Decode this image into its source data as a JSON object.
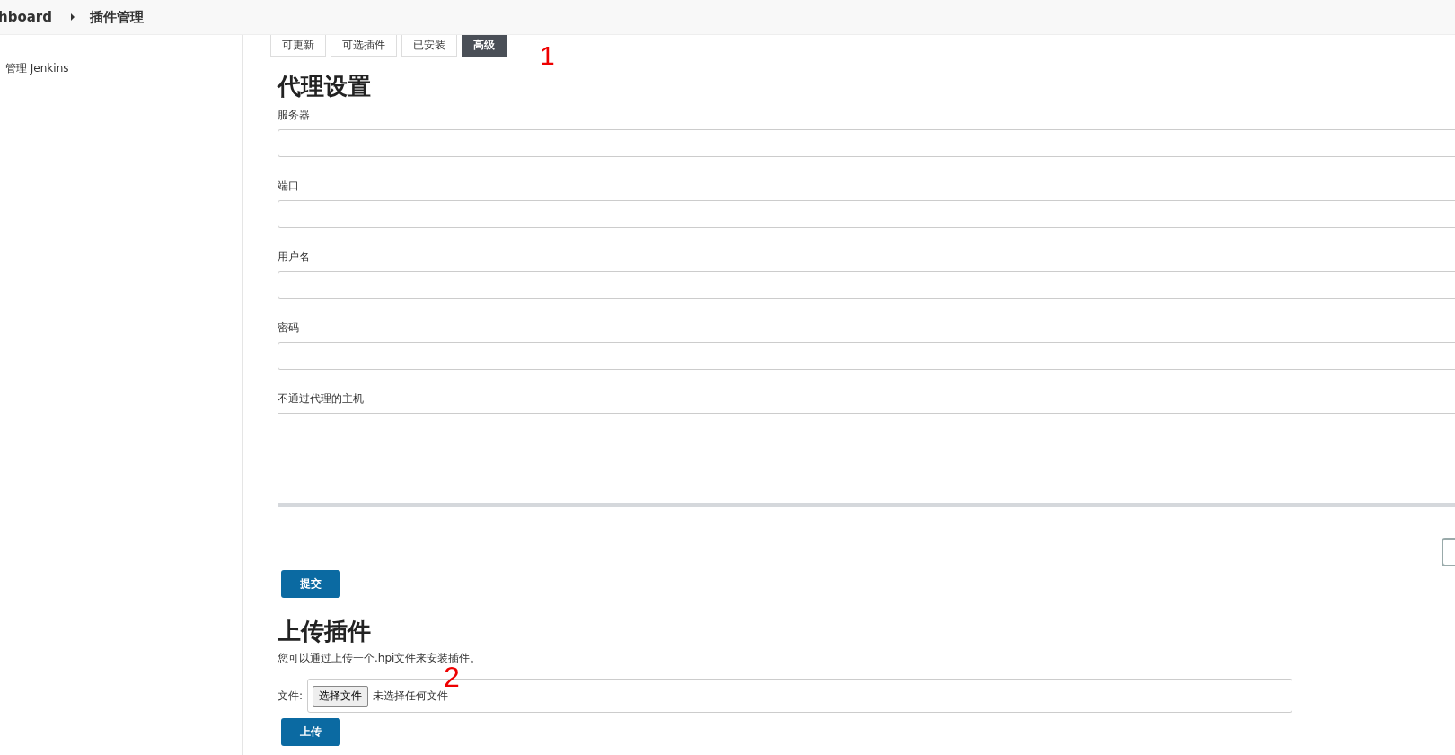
{
  "breadcrumb": [
    {
      "label": "hboard"
    },
    {
      "label": "插件管理"
    }
  ],
  "sidebar": {
    "items": [
      {
        "label": "管理 Jenkins"
      }
    ]
  },
  "tabs": [
    {
      "label": "可更新",
      "selected": false
    },
    {
      "label": "可选插件",
      "selected": false
    },
    {
      "label": "已安装",
      "selected": false
    },
    {
      "label": "高级",
      "selected": true
    }
  ],
  "proxy": {
    "title": "代理设置",
    "fields": [
      {
        "label": "服务器",
        "kind": "input"
      },
      {
        "label": "端口",
        "kind": "input"
      },
      {
        "label": "用户名",
        "kind": "input"
      },
      {
        "label": "密码",
        "kind": "input"
      },
      {
        "label": "不通过代理的主机",
        "kind": "textarea"
      }
    ],
    "submit": "提交"
  },
  "upload": {
    "title": "上传插件",
    "description": "您可以通过上传一个.hpi文件来安装插件。",
    "file_label": "文件:",
    "choose_button": "选择文件",
    "no_file": "未选择任何文件",
    "submit": "上传"
  },
  "annotations": [
    "1",
    "2"
  ]
}
